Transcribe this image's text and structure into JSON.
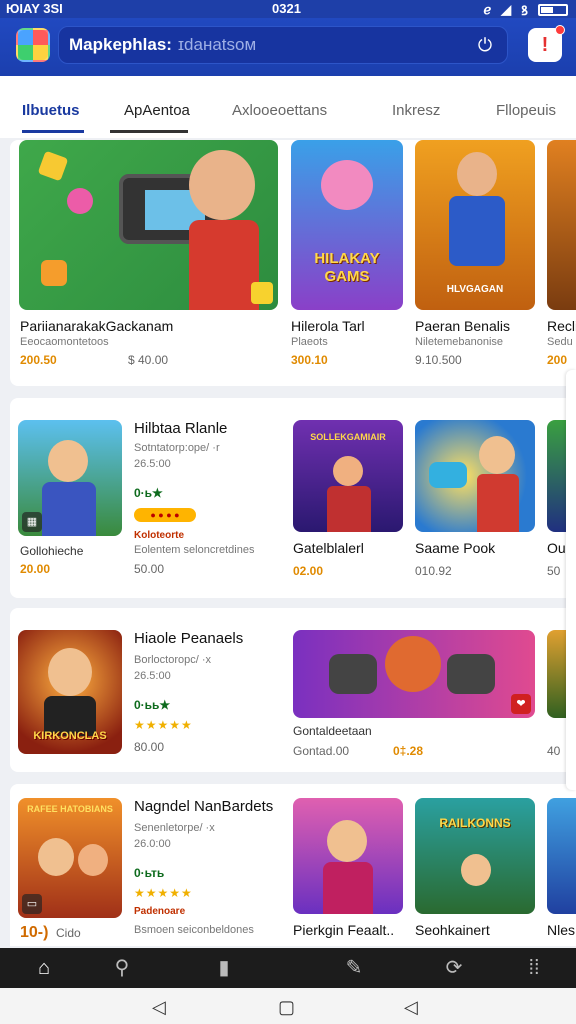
{
  "status": {
    "left": "ЮIAY 3SI",
    "center": "0321",
    "icons": [
      "e-icon",
      "wifi-icon",
      "signal-icon"
    ]
  },
  "appbar": {
    "query": "Mapkephlas:",
    "placeholder": "ɪdaнatsoм"
  },
  "tabs": [
    {
      "label": "Ilbuetus"
    },
    {
      "label": "ApAentoa"
    },
    {
      "label": "Axlooeoettans"
    },
    {
      "label": "Inkresz"
    },
    {
      "label": "Fllopeuis"
    }
  ],
  "colors": {
    "brand": "#1e3fa8",
    "accent": "#e08a00",
    "rating": "#0e6b1d"
  },
  "card1": {
    "items": [
      {
        "title": "PariianarakakGackanam",
        "sub": "Eeocaomontetoos",
        "price": "200.50",
        "price2": "$ 40.00"
      },
      {
        "title": "Hilerola Tarl",
        "sub": "Plaeots",
        "price": "300.10"
      },
      {
        "title": "Paeran Benalis",
        "sub": "Niletemebanonise",
        "price": "9.10.500"
      },
      {
        "title": "Recli",
        "sub": "Sedu",
        "price": "200"
      }
    ],
    "poster_text": "HILAKAY GAMS",
    "poster2_text": "HLVGAGAN"
  },
  "card2": {
    "feature": {
      "title": "Hilbtaa Rlanle",
      "sub1": "Sotntatorp:ope/ ·r",
      "sub2": "26.5:00",
      "rating": "0·ь★",
      "promo": "● ● ● ●",
      "kicker": "Koloteorte",
      "sub3": "Eolentem seloncretdines",
      "price": "50.00"
    },
    "thumb_caption": "Gollohieche",
    "thumb_price": "20.00",
    "items": [
      {
        "title": "Gatelblalerl",
        "price": "02.00"
      },
      {
        "title": "Saame Pook",
        "price": "010.92"
      },
      {
        "title": "Oua",
        "price": "50"
      }
    ],
    "poster_text": "SOLLEKGAMIAIR"
  },
  "card3": {
    "feature": {
      "title": "Hiaole Peanaels",
      "sub1": "Borloctoropc/ ·x",
      "sub2": "26.5:00",
      "rating": "0·ьь★",
      "stars": "★★★★★",
      "price": "80.00"
    },
    "thumb_text": "KIRKONCLAS",
    "wide": {
      "caption": "Gontaldeetaan",
      "sub": "Gontad.00",
      "price": "0‡.28"
    },
    "side_price": "40"
  },
  "card4": {
    "feature": {
      "title": "Nagndel NanBardets",
      "sub1": "Senenletorpe/ ·x",
      "sub2": "26.0:00",
      "rating": "0·ьть",
      "stars": "★★★★★",
      "kicker": "Padenoare",
      "sub3": "Bsmoen seiconbeldones"
    },
    "thumb_text": "RAFEE HATOBIANS",
    "thumb_price": "10-)",
    "thumb_price2": "Cido",
    "items": [
      {
        "title": "Pierkgin Feaalt.."
      },
      {
        "title": "Seohkainert"
      },
      {
        "title": "Nles"
      }
    ],
    "poster_text": "RAILKONNS"
  },
  "nav": [
    "home-icon",
    "search-icon",
    "alert-icon",
    "brush-icon",
    "refresh-icon",
    "grid-icon"
  ]
}
